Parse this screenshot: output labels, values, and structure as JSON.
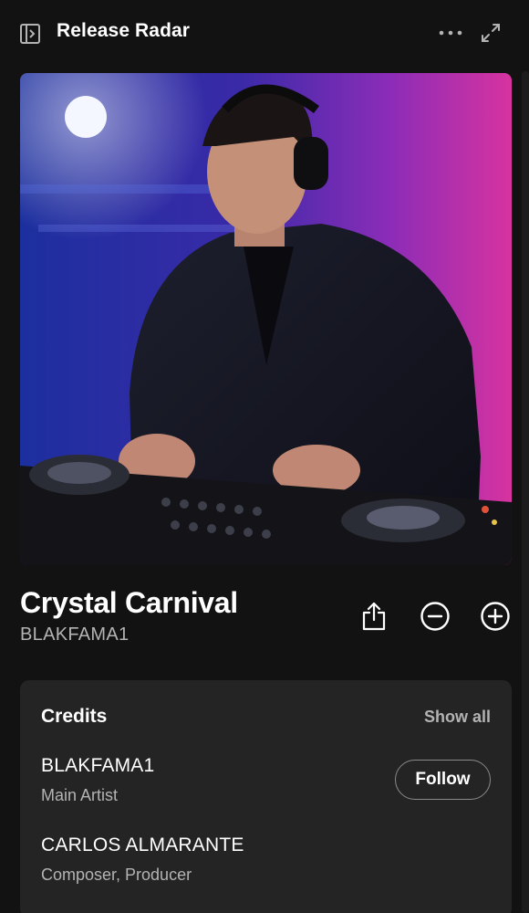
{
  "header": {
    "title": "Release Radar",
    "left_icon": "sidebar-panel-icon",
    "more_icon": "more-options-icon",
    "expand_icon": "expand-fullscreen-icon"
  },
  "cover": {
    "description_icon": "album-cover-image"
  },
  "track": {
    "title": "Crystal Carnival",
    "artist": "BLAKFAMA1",
    "share_icon": "share-icon",
    "remove_icon": "minus-circle-icon",
    "add_icon": "plus-circle-icon"
  },
  "credits": {
    "heading": "Credits",
    "show_all": "Show all",
    "people": [
      {
        "name": "BLAKFAMA1",
        "role": "Main Artist",
        "follow_label": "Follow"
      },
      {
        "name": "CARLOS ALMARANTE",
        "role": "Composer, Producer"
      }
    ]
  },
  "colors": {
    "background": "#121212",
    "card": "#242424",
    "text_primary": "#ffffff",
    "text_secondary": "#b3b3b3"
  }
}
